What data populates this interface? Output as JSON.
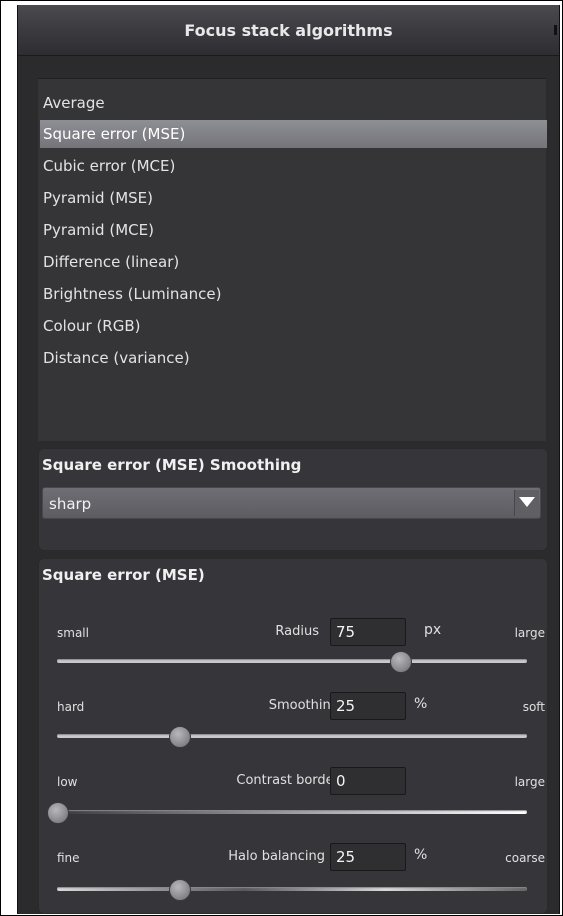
{
  "window": {
    "title": "Focus stack algorithms"
  },
  "algorithms": {
    "items": [
      "Average",
      "Square error (MSE)",
      "Cubic error (MCE)",
      "Pyramid (MSE)",
      "Pyramid (MCE)",
      "Difference (linear)",
      "Brightness (Luminance)",
      "Colour (RGB)",
      "Distance (variance)"
    ],
    "selected": "Square error (MSE)"
  },
  "smoothing_group": {
    "title": "Square error (MSE) Smoothing",
    "selected_value": "sharp"
  },
  "params_group": {
    "title": "Square error (MSE)",
    "sliders": [
      {
        "name": "Radius",
        "value": "75",
        "unit": "px",
        "left_label": "small",
        "right_label": "large",
        "fraction": 0.73
      },
      {
        "name": "Smoothing",
        "value": "25",
        "unit": "%",
        "left_label": "hard",
        "right_label": "soft",
        "fraction": 0.26
      },
      {
        "name": "Contrast border",
        "value": "0",
        "unit": "",
        "left_label": "low",
        "right_label": "large",
        "fraction": 0.0
      },
      {
        "name": "Halo balancing",
        "value": "25",
        "unit": "%",
        "left_label": "fine",
        "right_label": "coarse",
        "fraction": 0.26
      }
    ]
  }
}
